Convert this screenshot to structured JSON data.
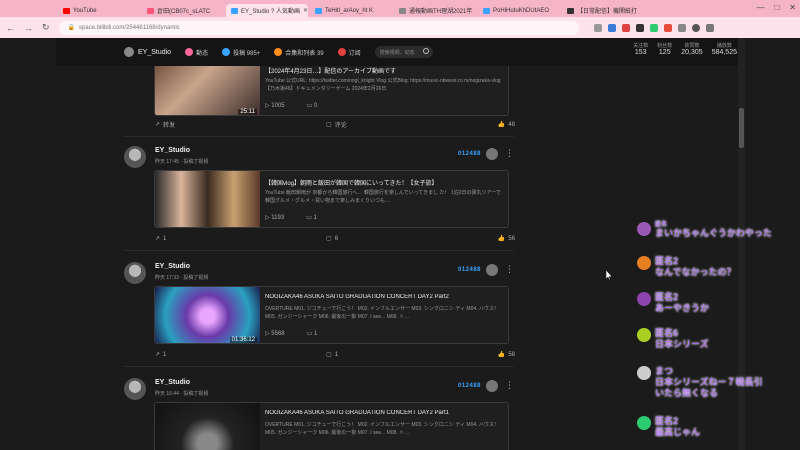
{
  "browser": {
    "tabs": [
      {
        "label": "YouTube",
        "color": "#ff0000"
      },
      {
        "label": "倉田(CB07c_sLATC",
        "color": "#ff5577"
      },
      {
        "label": "EY_Studio ? 人気動画",
        "color": "#3aa3ff",
        "active": true
      },
      {
        "label": "TeHitl_arAoy_ht K",
        "color": "#3aa3ff"
      },
      {
        "label": "通報動画TH理湖2021年",
        "color": "#888888"
      },
      {
        "label": "PoHiHutuKhDUtAEO",
        "color": "#3aa3ff"
      },
      {
        "label": "【日常配信】機関紙打",
        "color": "#333333"
      }
    ],
    "url": "space.bilibili.com/254461168/dynamic",
    "window_controls": [
      "—",
      "□",
      "✕"
    ]
  },
  "header": {
    "username": "EY_Studio",
    "nav": [
      {
        "label": "動态",
        "color": "#ff6699"
      },
      {
        "label": "投稿 985+",
        "color": "#3aa3ff"
      },
      {
        "label": "合集和列表 39",
        "color": "#ff8c1a"
      },
      {
        "label": "订阅",
        "color": "#e04040"
      }
    ],
    "search_placeholder": "搜索视频、动态",
    "stats": [
      {
        "label": "关注数",
        "value": "153"
      },
      {
        "label": "粉丝数",
        "value": "125"
      },
      {
        "label": "获赞数",
        "value": "20,305"
      },
      {
        "label": "播放数",
        "value": "584,525"
      }
    ]
  },
  "posts": [
    {
      "author": "",
      "time": "",
      "card": {
        "title": "【2024年4月23日…】配信のアーカイブ動画です",
        "desc": "YouTube 公式URL: https://twitter.com/nogi_knight Vlog 公式Blog: https://music-nbwear.co m/nogizaka-vlog 【乃木坂46】ドキュメンタリーゲーム 2024年2月26日",
        "duration": "25:11",
        "views": "1005",
        "danmaku": "0"
      },
      "actions": {
        "share": "转发",
        "comment": "评论",
        "like": "48"
      }
    },
    {
      "author": "EY_Studio",
      "time": "昨天 17:45 · 投稿了视频",
      "badge": "012488",
      "card": {
        "title": "【韓国vlog】朝雨と飯田が韓国で韓国にいってきた！【女子旅】",
        "desc": "YouTube 飯田朝雨が 京都から韓国旅行へ… 韓国旅行を楽しんでいってきまし た！ 1泊2日の弾丸ツアーで韓国グルメ・グルメ・買い物まで楽しみまくりいつも…",
        "duration": "",
        "views": "1193",
        "danmaku": "1"
      },
      "actions": {
        "share": "1",
        "comment": "6",
        "like": "56"
      }
    },
    {
      "author": "EY_Studio",
      "time": "昨天 17:33 · 投稿了视频",
      "badge": "012488",
      "card": {
        "title": "NOGIZAKA46 ASUKA SAITO GRADUATION CONCERT DAY2 Part2",
        "desc": "OVERTURE M01. ジコチューで行こう！ M02. インフルエンサー M03. シンクロニシ ティ M04. ハウス！ M05. ガンジーシャーク M06. 最後の一掛 M07. I see... M08. ト…",
        "duration": "01:36:12",
        "views": "5568",
        "danmaku": "1"
      },
      "actions": {
        "share": "1",
        "comment": "1",
        "like": "58"
      }
    },
    {
      "author": "EY_Studio",
      "time": "昨天 16:44 · 投稿了视频",
      "badge": "012488",
      "card": {
        "title": "NOGIZAKA46 ASUKA SAITO GRADUATION CONCERT DAY2 Part1",
        "desc": "OVERTURE M01. ジコチューで行こう！ M02. インフルエンサー M03. シンクロニシ ティ M04. ハウス！ M05. ガンジーシャーク M06. 最後の一掛 M07. I see... M08. ト…",
        "duration": "",
        "views": "",
        "danmaku": ""
      }
    }
  ],
  "chat": [
    {
      "name": "匿名",
      "text": "まいかちゃんぐうかわやった",
      "avatar_color": "#9b59b6"
    },
    {
      "name": "匿名2",
      "text": "なんでなかったの？",
      "avatar_color": "#e67e22"
    },
    {
      "name": "匿名2",
      "text": "あーやきうか",
      "avatar_color": "#8e44ad"
    },
    {
      "name": "匿名6",
      "text": "日本シリーズ",
      "avatar_color": "#a8d020"
    },
    {
      "name": "まつ",
      "text": "日本シリーズねー７戦長引",
      "text2": "いたら無くなる",
      "avatar_color": "#cccccc"
    },
    {
      "name": "匿名2",
      "text": "最高じゃん",
      "avatar_color": "#2ecc71"
    }
  ]
}
